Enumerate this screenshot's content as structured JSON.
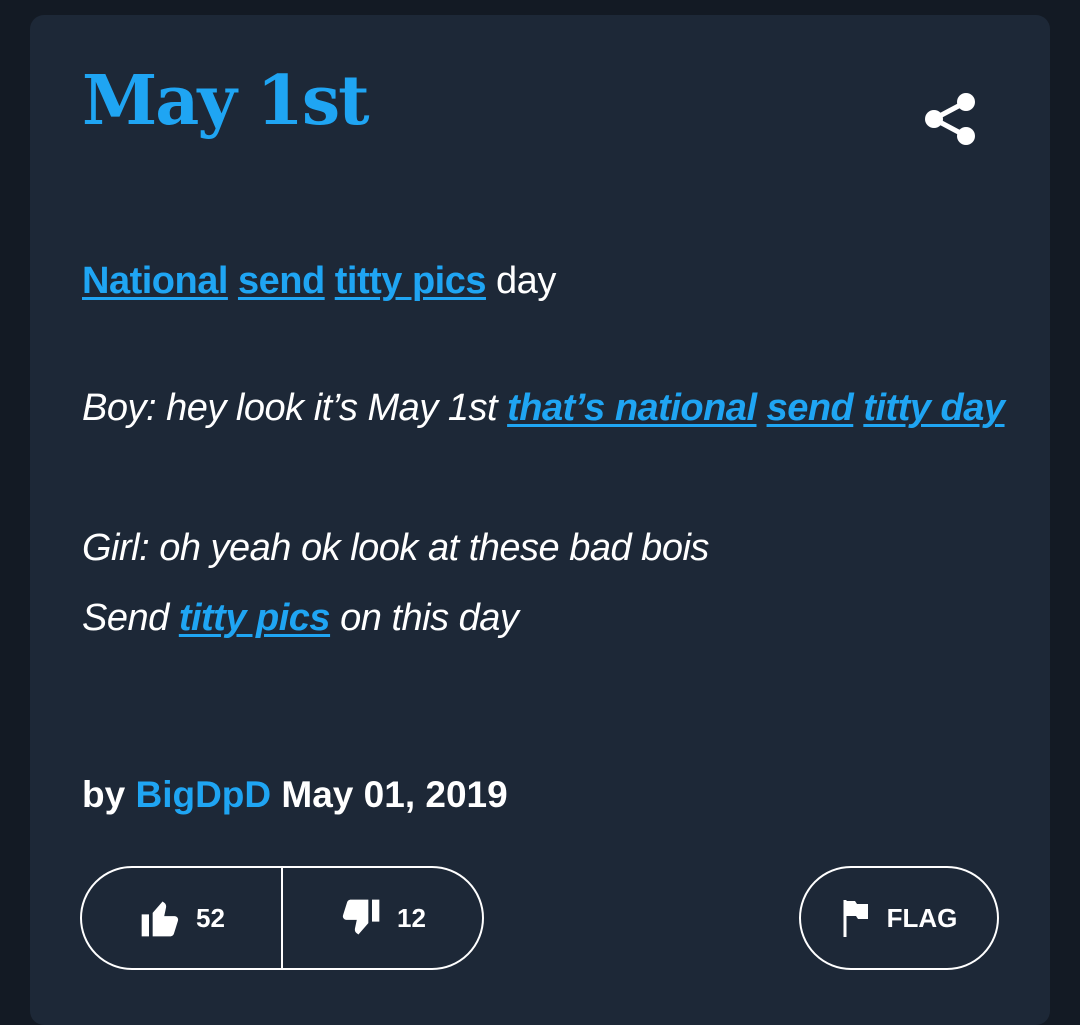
{
  "entry": {
    "word": "May 1st",
    "definition": {
      "links": [
        "National",
        "send",
        "titty pics"
      ],
      "tail": "day"
    },
    "example": {
      "line1_text": "Boy: hey look it’s May 1st ",
      "line1_links": [
        "that’s national",
        "send",
        "titty day"
      ],
      "line3": "Girl: oh yeah ok look at these bad bois",
      "line4_prefix": "Send ",
      "line4_link": "titty pics",
      "line4_suffix": " on this day"
    },
    "byline": {
      "prefix": "by",
      "author": "BigDpD",
      "date": "May 01, 2019"
    }
  },
  "actions": {
    "upvotes": "52",
    "downvotes": "12",
    "flag_label": "FLAG"
  },
  "icons": {
    "share": "share-icon",
    "thumbs_up": "thumbs-up-icon",
    "thumbs_down": "thumbs-down-icon",
    "flag": "flag-icon"
  },
  "colors": {
    "accent": "#1fa5f3",
    "card_background": "#1d2837",
    "page_background": "#131a24",
    "text": "#ffffff"
  }
}
